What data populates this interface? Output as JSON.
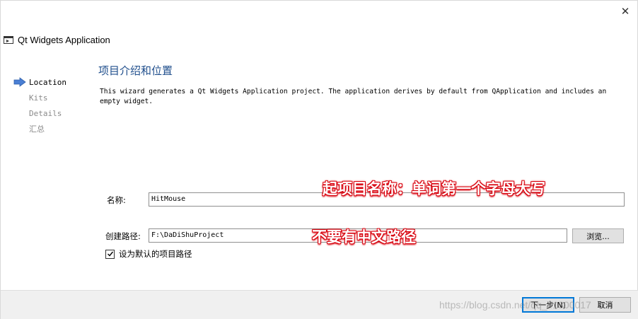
{
  "window": {
    "close_glyph": "✕"
  },
  "header": {
    "icon": "application-window-icon",
    "title": "Qt Widgets Application"
  },
  "sidebar": {
    "items": [
      {
        "label": "Location",
        "active": true
      },
      {
        "label": "Kits",
        "active": false
      },
      {
        "label": "Details",
        "active": false
      },
      {
        "label": "汇总",
        "active": false
      }
    ]
  },
  "main": {
    "title": "项目介绍和位置",
    "description": "This wizard generates a Qt Widgets Application project. The application derives by default from QApplication and includes an empty widget.",
    "name_label": "名称:",
    "name_value": "HitMouse",
    "path_label": "创建路径:",
    "path_value": "F:\\DaDiShuProject",
    "browse_label": "浏览...",
    "default_checkbox_label": "设为默认的项目路径",
    "default_checked": true
  },
  "annotations": {
    "name_note": "起项目名称：单词第一个字母大写",
    "path_note": "不要有中文路径"
  },
  "footer": {
    "next_label": "下一步(N)",
    "cancel_label": "取消"
  },
  "watermark": "https://blog.csdn.net/qq_41300017",
  "colors": {
    "accent": "#1f4e8c",
    "arrow": "#4a7fd4",
    "annotation": "#d8000c",
    "focus": "#0078d7"
  }
}
